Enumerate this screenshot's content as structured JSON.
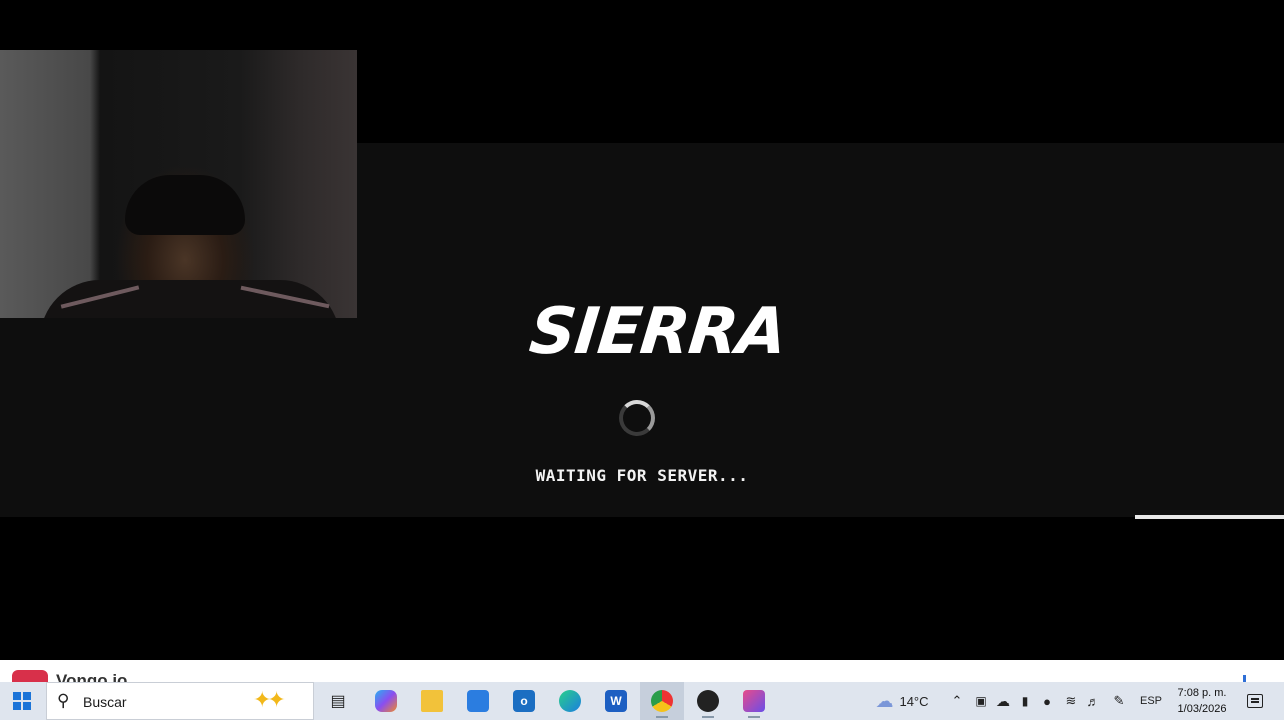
{
  "game": {
    "logo_text": "SIERRA",
    "status_text": "WAITING FOR SERVER...",
    "progress_percent": 11.6
  },
  "notification": {
    "app_name": "Vongo.io"
  },
  "taskbar": {
    "search_placeholder": "Buscar",
    "apps": [
      {
        "name": "task-view",
        "icon": "task-view-icon"
      },
      {
        "name": "copilot",
        "icon": "copilot-icon"
      },
      {
        "name": "file-explorer",
        "icon": "folder-icon"
      },
      {
        "name": "microsoft-store",
        "icon": "store-icon"
      },
      {
        "name": "outlook",
        "icon": "outlook-icon"
      },
      {
        "name": "edge",
        "icon": "edge-icon"
      },
      {
        "name": "word",
        "icon": "word-icon"
      },
      {
        "name": "chrome",
        "icon": "chrome-icon",
        "active": true
      },
      {
        "name": "obs-studio",
        "icon": "obs-icon"
      },
      {
        "name": "game-app",
        "icon": "game-app-icon"
      }
    ],
    "weather_temp": "14°C",
    "language": "ESP",
    "time": "7:08 p. m.",
    "date": "1/03/2026"
  }
}
